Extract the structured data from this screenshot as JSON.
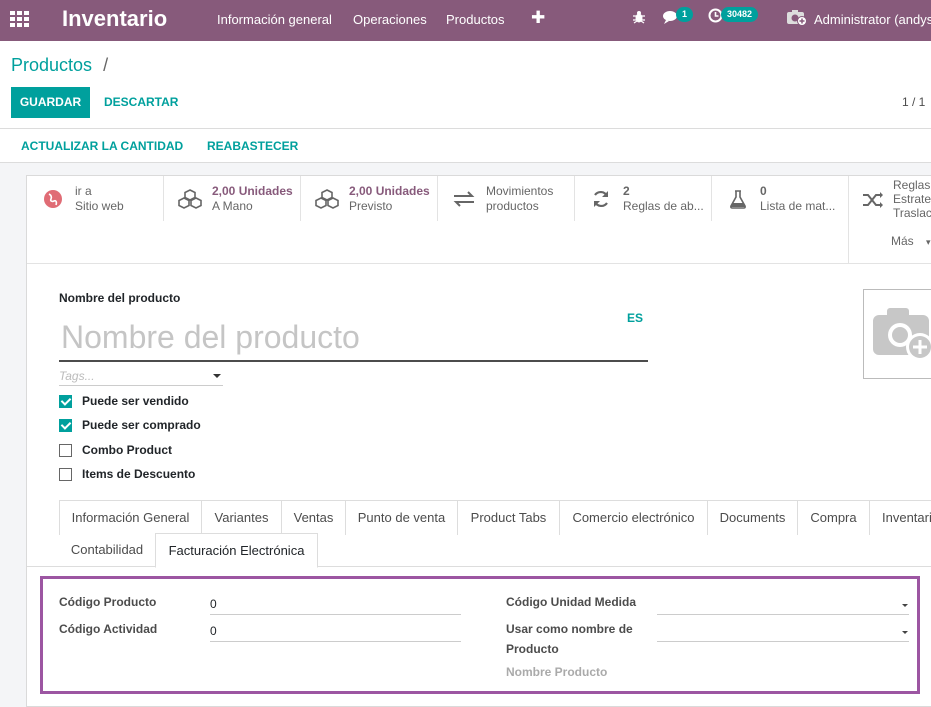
{
  "navbar": {
    "app_title": "Inventario",
    "menu": [
      "Información general",
      "Operaciones",
      "Productos"
    ],
    "messages_badge": "1",
    "activities_badge": "30482",
    "user": "Administrator (andys"
  },
  "control": {
    "breadcrumb": "Productos",
    "breadcrumb_sep": "/",
    "save": "GUARDAR",
    "discard": "DESCARTAR",
    "pager": "1 / 1"
  },
  "header_buttons": [
    "ACTUALIZAR LA CANTIDAD",
    "REABASTECER"
  ],
  "smart_buttons": [
    {
      "icon": "globe-icon",
      "value": "ir a",
      "label": "Sitio web"
    },
    {
      "icon": "cubes-icon",
      "value": "2,00 Unidades",
      "label": "A Mano"
    },
    {
      "icon": "cubes-icon",
      "value": "2,00 Unidades",
      "label": "Previsto"
    },
    {
      "icon": "exchange-icon",
      "value": "Movimientos",
      "label": "productos"
    },
    {
      "icon": "refresh-icon",
      "value": "2",
      "label": "Reglas de ab..."
    },
    {
      "icon": "flask-icon",
      "value": "0",
      "label": "Lista de mat..."
    }
  ],
  "more_box": {
    "lines": [
      "Reglas",
      "Estrate",
      "Traslac"
    ],
    "more": "Más"
  },
  "form": {
    "name_label": "Nombre del producto",
    "name_placeholder": "Nombre del producto",
    "lang": "ES",
    "tags_placeholder": "Tags...",
    "checkboxes": [
      {
        "label": "Puede ser vendido",
        "checked": true
      },
      {
        "label": "Puede ser comprado",
        "checked": true
      },
      {
        "label": "Combo Product",
        "checked": false
      },
      {
        "label": "Items de Descuento",
        "checked": false
      }
    ]
  },
  "tabs_row1": [
    "Información General",
    "Variantes",
    "Ventas",
    "Punto de venta",
    "Product Tabs",
    "Comercio electrónico",
    "Documents",
    "Compra",
    "Inventari"
  ],
  "tabs_row2": [
    "Contabilidad",
    "Facturación Electrónica"
  ],
  "pane": {
    "codigo_producto_label": "Código Producto",
    "codigo_producto_value": "0",
    "codigo_actividad_label": "Código Actividad",
    "codigo_actividad_value": "0",
    "codigo_unidad_label": "Código Unidad Medida",
    "usar_nombre_label_1": "Usar como nombre de",
    "usar_nombre_label_2": "Producto",
    "nombre_producto_label": "Nombre Producto"
  },
  "colors": {
    "brand": "#875a7b",
    "accent": "#00a09d",
    "highlight": "#9c56a2"
  }
}
